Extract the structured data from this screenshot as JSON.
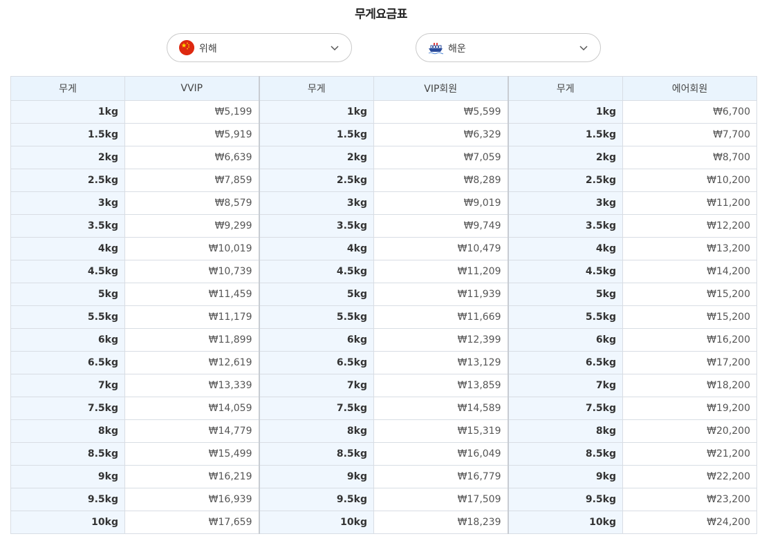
{
  "title": "무게요금표",
  "selects": {
    "origin": {
      "label": "위해",
      "icon": "china-flag-icon"
    },
    "method": {
      "label": "해운",
      "icon": "ship-icon"
    }
  },
  "table": {
    "headers": [
      "무게",
      "VVIP",
      "무게",
      "VIP회원",
      "무게",
      "에어회원"
    ],
    "rows": [
      [
        "1kg",
        "₩5,199",
        "1kg",
        "₩5,599",
        "1kg",
        "₩6,700"
      ],
      [
        "1.5kg",
        "₩5,919",
        "1.5kg",
        "₩6,329",
        "1.5kg",
        "₩7,700"
      ],
      [
        "2kg",
        "₩6,639",
        "2kg",
        "₩7,059",
        "2kg",
        "₩8,700"
      ],
      [
        "2.5kg",
        "₩7,859",
        "2.5kg",
        "₩8,289",
        "2.5kg",
        "₩10,200"
      ],
      [
        "3kg",
        "₩8,579",
        "3kg",
        "₩9,019",
        "3kg",
        "₩11,200"
      ],
      [
        "3.5kg",
        "₩9,299",
        "3.5kg",
        "₩9,749",
        "3.5kg",
        "₩12,200"
      ],
      [
        "4kg",
        "₩10,019",
        "4kg",
        "₩10,479",
        "4kg",
        "₩13,200"
      ],
      [
        "4.5kg",
        "₩10,739",
        "4.5kg",
        "₩11,209",
        "4.5kg",
        "₩14,200"
      ],
      [
        "5kg",
        "₩11,459",
        "5kg",
        "₩11,939",
        "5kg",
        "₩15,200"
      ],
      [
        "5.5kg",
        "₩11,179",
        "5.5kg",
        "₩11,669",
        "5.5kg",
        "₩15,200"
      ],
      [
        "6kg",
        "₩11,899",
        "6kg",
        "₩12,399",
        "6kg",
        "₩16,200"
      ],
      [
        "6.5kg",
        "₩12,619",
        "6.5kg",
        "₩13,129",
        "6.5kg",
        "₩17,200"
      ],
      [
        "7kg",
        "₩13,339",
        "7kg",
        "₩13,859",
        "7kg",
        "₩18,200"
      ],
      [
        "7.5kg",
        "₩14,059",
        "7.5kg",
        "₩14,589",
        "7.5kg",
        "₩19,200"
      ],
      [
        "8kg",
        "₩14,779",
        "8kg",
        "₩15,319",
        "8kg",
        "₩20,200"
      ],
      [
        "8.5kg",
        "₩15,499",
        "8.5kg",
        "₩16,049",
        "8.5kg",
        "₩21,200"
      ],
      [
        "9kg",
        "₩16,219",
        "9kg",
        "₩16,779",
        "9kg",
        "₩22,200"
      ],
      [
        "9.5kg",
        "₩16,939",
        "9.5kg",
        "₩17,509",
        "9.5kg",
        "₩23,200"
      ],
      [
        "10kg",
        "₩17,659",
        "10kg",
        "₩18,239",
        "10kg",
        "₩24,200"
      ]
    ]
  }
}
